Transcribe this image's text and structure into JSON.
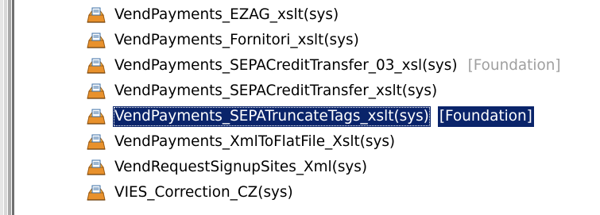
{
  "tree": {
    "items": [
      {
        "label": "VendPayments_EZAG_xslt(sys)",
        "tag": "",
        "icon": "folder-document-icon",
        "selected": false
      },
      {
        "label": "VendPayments_Fornitori_xslt(sys)",
        "tag": "",
        "icon": "folder-document-icon",
        "selected": false
      },
      {
        "label": "VendPayments_SEPACreditTransfer_03_xsl(sys)",
        "tag": "[Foundation]",
        "icon": "folder-document-icon",
        "selected": false
      },
      {
        "label": "VendPayments_SEPACreditTransfer_xslt(sys)",
        "tag": "",
        "icon": "folder-document-icon",
        "selected": false
      },
      {
        "label": "VendPayments_SEPATruncateTags_xslt(sys)",
        "tag": "[Foundation]",
        "icon": "folder-document-icon",
        "selected": true
      },
      {
        "label": "VendPayments_XmlToFlatFile_Xslt(sys)",
        "tag": "",
        "icon": "folder-document-icon",
        "selected": false
      },
      {
        "label": "VendRequestSignupSites_Xml(sys)",
        "tag": "",
        "icon": "folder-document-icon",
        "selected": false
      },
      {
        "label": "VIES_Correction_CZ(sys)",
        "tag": "",
        "icon": "folder-document-icon",
        "selected": false
      }
    ]
  },
  "colors": {
    "selection_bg": "#0a246a",
    "selection_fg": "#ffffff",
    "tag_fg": "#a0a0a0",
    "icon_orange": "#e8912c",
    "icon_blue": "#3a6ea5"
  }
}
